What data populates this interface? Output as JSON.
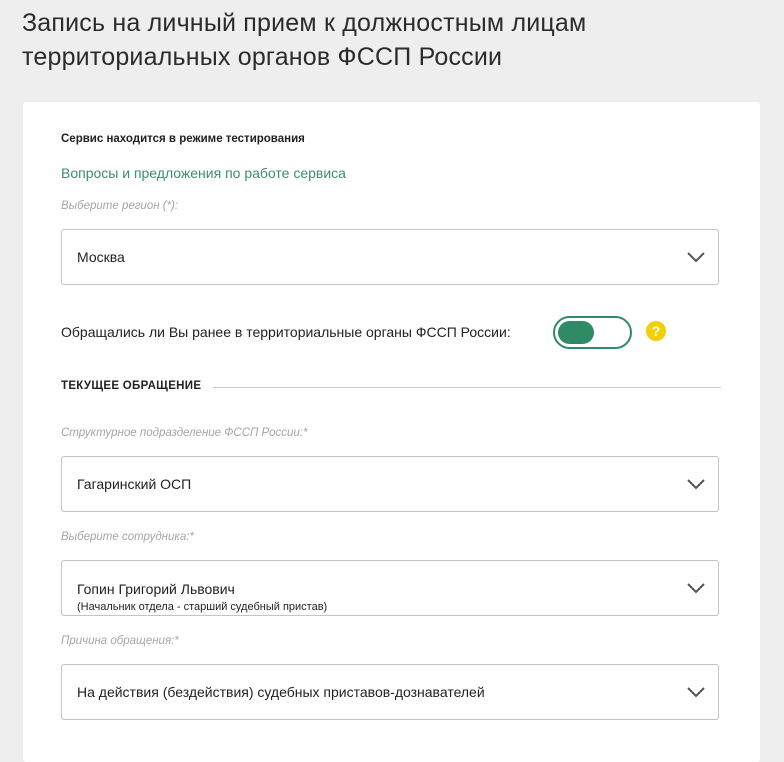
{
  "page": {
    "title": "Запись на личный прием к должностным лицам территориальных органов ФССП России"
  },
  "form": {
    "notice": "Сервис находится в режиме тестирования",
    "feedback_link": "Вопросы и предложения по работе сервиса",
    "region": {
      "label": "Выберите регион (*):",
      "value": "Москва"
    },
    "prior_contact": {
      "question": "Обращались ли Вы ранее в территориальные органы ФССП России:",
      "toggle_on": false,
      "help_icon_glyph": "?"
    },
    "section_title": "ТЕКУЩЕЕ ОБРАЩЕНИЕ",
    "division": {
      "label": "Структурное подразделение ФССП России:*",
      "value": "Гагаринский ОСП"
    },
    "employee": {
      "label": "Выберите сотрудника:*",
      "value": "Гопин Григорий Львович",
      "subtitle": "(Начальник отдела - старший судебный пристав)"
    },
    "reason": {
      "label": "Причина обращения:*",
      "value": "На действия (бездействия) судебных приставов-дознавателей"
    }
  },
  "colors": {
    "accent": "#2e8b66",
    "link": "#3d8d6b",
    "help": "#f2cf00",
    "background": "#eeeeee",
    "card": "#ffffff"
  },
  "icons": {
    "dropdown": "chevron-down-icon",
    "help": "question-circle-icon"
  }
}
